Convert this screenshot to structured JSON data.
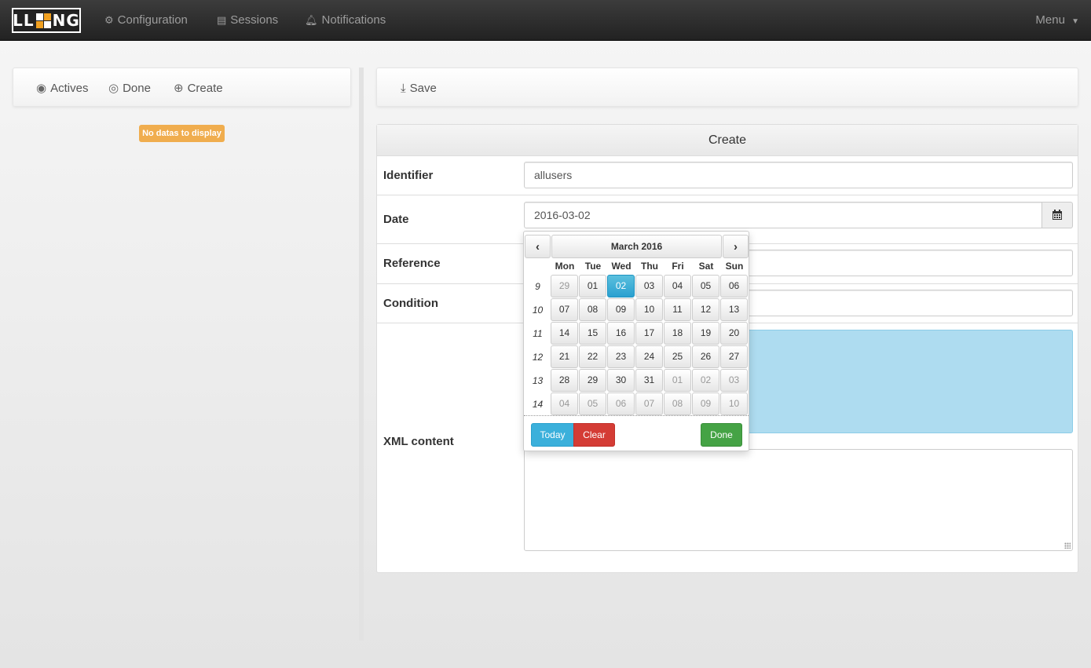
{
  "navbar": {
    "logo": {
      "left": "LL",
      "right": "NG"
    },
    "items": [
      {
        "icon": "gear-icon",
        "label": "Configuration"
      },
      {
        "icon": "documents-icon",
        "label": "Sessions"
      },
      {
        "icon": "bell-icon",
        "label": "Notifications"
      }
    ],
    "menu_label": "Menu"
  },
  "left_panel": {
    "tabs": [
      {
        "icon": "eye-icon",
        "label": "Actives"
      },
      {
        "icon": "eye-slash-icon",
        "label": "Done"
      },
      {
        "icon": "plus-circle-icon",
        "label": "Create"
      }
    ],
    "empty_message": "No datas to display"
  },
  "right_panel": {
    "save_label": "Save",
    "form_title": "Create",
    "fields": {
      "identifier": {
        "label": "Identifier",
        "value": "allusers"
      },
      "date": {
        "label": "Date",
        "value": "2016-03-02"
      },
      "reference": {
        "label": "Reference",
        "value": ""
      },
      "condition": {
        "label": "Condition",
        "value": ""
      },
      "xml": {
        "label": "XML content",
        "value": ""
      }
    }
  },
  "datepicker": {
    "title": "March 2016",
    "prev": "‹",
    "next": "›",
    "days_of_week": [
      "Mon",
      "Tue",
      "Wed",
      "Thu",
      "Fri",
      "Sat",
      "Sun"
    ],
    "weeks": [
      {
        "num": "9",
        "days": [
          {
            "d": "29",
            "m": true
          },
          {
            "d": "01"
          },
          {
            "d": "02",
            "active": true
          },
          {
            "d": "03"
          },
          {
            "d": "04"
          },
          {
            "d": "05"
          },
          {
            "d": "06"
          }
        ]
      },
      {
        "num": "10",
        "days": [
          {
            "d": "07"
          },
          {
            "d": "08"
          },
          {
            "d": "09"
          },
          {
            "d": "10"
          },
          {
            "d": "11"
          },
          {
            "d": "12"
          },
          {
            "d": "13"
          }
        ]
      },
      {
        "num": "11",
        "days": [
          {
            "d": "14"
          },
          {
            "d": "15"
          },
          {
            "d": "16"
          },
          {
            "d": "17"
          },
          {
            "d": "18"
          },
          {
            "d": "19"
          },
          {
            "d": "20"
          }
        ]
      },
      {
        "num": "12",
        "days": [
          {
            "d": "21"
          },
          {
            "d": "22"
          },
          {
            "d": "23"
          },
          {
            "d": "24"
          },
          {
            "d": "25"
          },
          {
            "d": "26"
          },
          {
            "d": "27"
          }
        ]
      },
      {
        "num": "13",
        "days": [
          {
            "d": "28"
          },
          {
            "d": "29"
          },
          {
            "d": "30"
          },
          {
            "d": "31"
          },
          {
            "d": "01",
            "m": true
          },
          {
            "d": "02",
            "m": true
          },
          {
            "d": "03",
            "m": true
          }
        ]
      },
      {
        "num": "14",
        "days": [
          {
            "d": "04",
            "m": true
          },
          {
            "d": "05",
            "m": true
          },
          {
            "d": "06",
            "m": true
          },
          {
            "d": "07",
            "m": true
          },
          {
            "d": "08",
            "m": true
          },
          {
            "d": "09",
            "m": true
          },
          {
            "d": "10",
            "m": true
          }
        ]
      }
    ],
    "today_label": "Today",
    "clear_label": "Clear",
    "done_label": "Done"
  },
  "colors": {
    "navbar_bg": "#222222",
    "badge_warning": "#f0ad4e",
    "active_day": "#2aa0d0",
    "today_btn": "#3bb0db",
    "clear_btn": "#d43c35",
    "done_btn": "#45a345",
    "selection_bg": "#aedcf0"
  }
}
